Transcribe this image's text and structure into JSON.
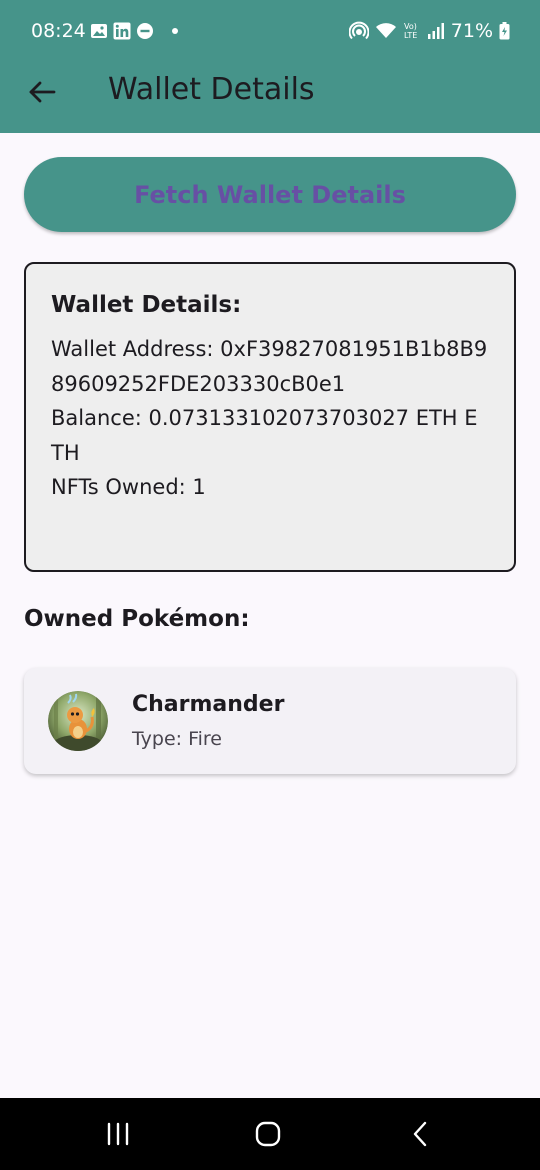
{
  "status_bar": {
    "time": "08:24",
    "battery": "71%",
    "left_icons": [
      "gallery-icon",
      "linkedin-icon",
      "dnd-icon",
      "dot-icon"
    ],
    "right_icons": [
      "hotspot-icon",
      "wifi-icon",
      "volte-icon",
      "signal-icon",
      "battery-icon"
    ]
  },
  "app_bar": {
    "title": "Wallet Details",
    "back_icon": "arrow-left-icon"
  },
  "fetch_button": {
    "label": "Fetch Wallet Details"
  },
  "wallet": {
    "heading": "Wallet Details:",
    "address_line": "Wallet Address: 0xF39827081951B1b8B989609252FDE203330cB0e1",
    "balance_line": "Balance: 0.073133102073703027 ETH ETH",
    "nfts_line": "NFTs Owned: 1"
  },
  "owned_section": {
    "title": "Owned Pokémon:"
  },
  "pokemon": [
    {
      "name": "Charmander",
      "type": "Type: Fire"
    }
  ],
  "colors": {
    "app_bar": "#46948a",
    "background": "#fbf8fd",
    "button_text": "#6750a4",
    "card_bg": "#eeeeee"
  },
  "nav_bar": {
    "icons": [
      "recent-apps-icon",
      "home-icon",
      "back-icon"
    ]
  }
}
